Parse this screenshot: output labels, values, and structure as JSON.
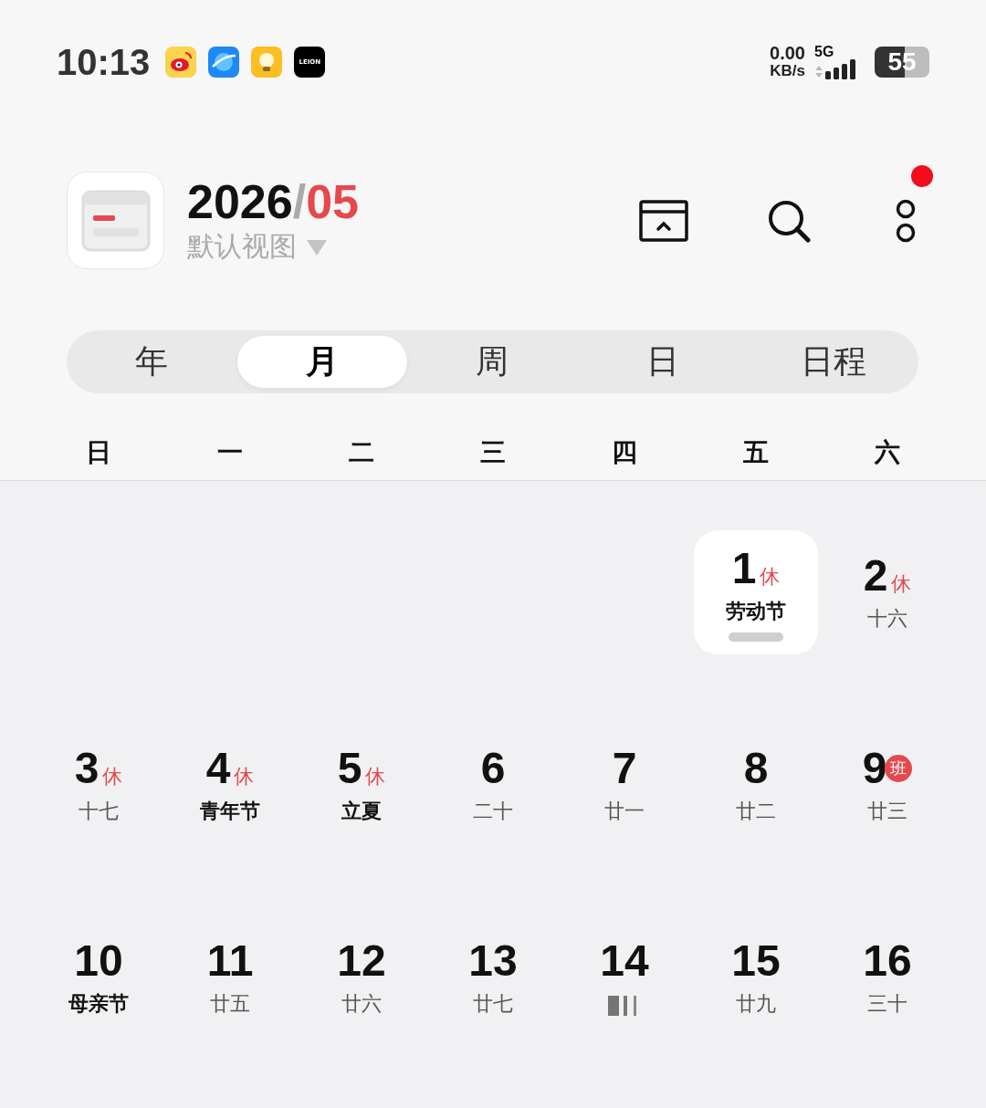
{
  "status_bar": {
    "time": "10:13",
    "apps": [
      {
        "kind": "weibo"
      },
      {
        "kind": "planet"
      },
      {
        "kind": "bulb"
      },
      {
        "kind": "leion",
        "label": "LEION"
      }
    ],
    "speed": "0.00",
    "speed_unit": "KB/s",
    "network": "5G",
    "battery": "55"
  },
  "header": {
    "year": "2026",
    "separator": "/",
    "month": "05",
    "view": "默认视图",
    "notification": true
  },
  "tabs": [
    {
      "label": "年",
      "selected": false
    },
    {
      "label": "月",
      "selected": true
    },
    {
      "label": "周",
      "selected": false
    },
    {
      "label": "日",
      "selected": false
    },
    {
      "label": "日程",
      "selected": false
    }
  ],
  "weekdays": [
    "日",
    "一",
    "二",
    "三",
    "四",
    "五",
    "六"
  ],
  "weeks": [
    [
      {
        "kind": "empty"
      },
      {
        "kind": "empty"
      },
      {
        "kind": "empty"
      },
      {
        "kind": "empty"
      },
      {
        "kind": "empty"
      },
      {
        "kind": "day",
        "day": "1",
        "badge": {
          "kind": "rest",
          "text": "休"
        },
        "note": "劳动节",
        "festival": true,
        "selected": true
      },
      {
        "kind": "day",
        "day": "2",
        "badge": {
          "kind": "rest",
          "text": "休"
        },
        "note": "十六",
        "festival": false,
        "selected": false
      }
    ],
    [
      {
        "kind": "day",
        "day": "3",
        "badge": {
          "kind": "rest",
          "text": "休"
        },
        "note": "十七",
        "festival": false,
        "selected": false
      },
      {
        "kind": "day",
        "day": "4",
        "badge": {
          "kind": "rest",
          "text": "休"
        },
        "note": "青年节",
        "festival": true,
        "selected": false
      },
      {
        "kind": "day",
        "day": "5",
        "badge": {
          "kind": "rest",
          "text": "休"
        },
        "note": "立夏",
        "festival": true,
        "selected": false
      },
      {
        "kind": "day",
        "day": "6",
        "note": "二十",
        "festival": false,
        "selected": false
      },
      {
        "kind": "day",
        "day": "7",
        "note": "廿一",
        "festival": false,
        "selected": false
      },
      {
        "kind": "day",
        "day": "8",
        "note": "廿二",
        "festival": false,
        "selected": false
      },
      {
        "kind": "day",
        "day": "9",
        "badge": {
          "kind": "work",
          "text": "班"
        },
        "note": "廿三",
        "festival": false,
        "selected": false
      }
    ],
    [
      {
        "kind": "day",
        "day": "10",
        "note": "母亲节",
        "festival": true,
        "selected": false
      },
      {
        "kind": "day",
        "day": "11",
        "note": "廿五",
        "festival": false,
        "selected": false
      },
      {
        "kind": "day",
        "day": "12",
        "note": "廿六",
        "festival": false,
        "selected": false
      },
      {
        "kind": "day",
        "day": "13",
        "note": "廿七",
        "festival": false,
        "selected": false
      },
      {
        "kind": "day",
        "day": "14",
        "selected": false
      },
      {
        "kind": "day",
        "day": "15",
        "note": "廿九",
        "festival": false,
        "selected": false
      },
      {
        "kind": "day",
        "day": "16",
        "note": "三十",
        "festival": false,
        "selected": false
      }
    ]
  ]
}
